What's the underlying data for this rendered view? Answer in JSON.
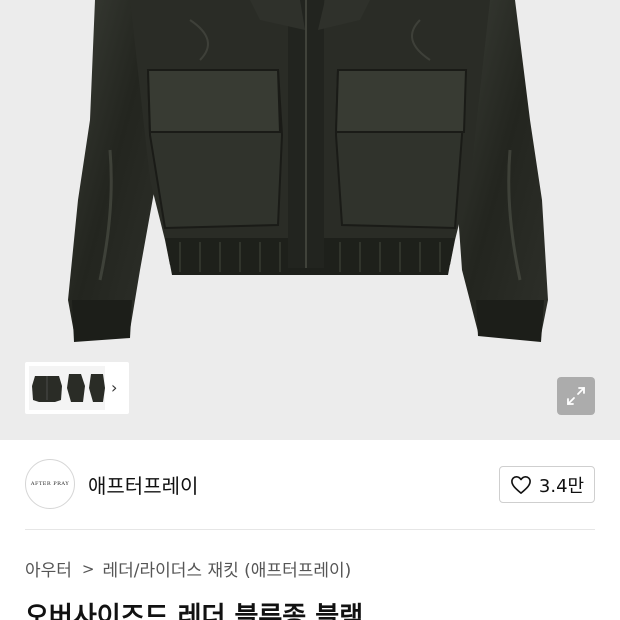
{
  "hero": {
    "image_alt": "jacket-photo",
    "thumbnail_next_icon": "chevron-right-icon",
    "expand_icon": "expand-icon"
  },
  "brand": {
    "logo_text": "AFTER PRAY",
    "name": "애프터프레이"
  },
  "like": {
    "icon": "heart-icon",
    "count": "3.4만"
  },
  "breadcrumb": {
    "category": "아우터",
    "separator": ">",
    "subcategory": "레더/라이더스 재킷 (애프터프레이)"
  },
  "product": {
    "title": "오버사이즈드 레더 블루종 블랙"
  }
}
